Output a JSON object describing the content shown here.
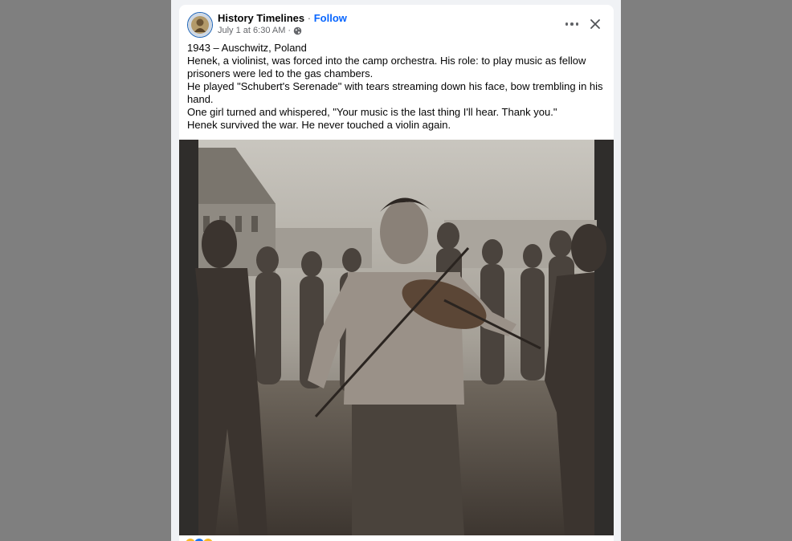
{
  "post": {
    "page_name": "History Timelines",
    "separator": "·",
    "follow_label": "Follow",
    "timestamp": "July 1 at 6:30 AM",
    "meta_separator": "·",
    "audience_icon": "globe-icon",
    "more_icon": "more-horizontal-icon",
    "close_icon": "close-icon",
    "text_lines": [
      "1943 – Auschwitz, Poland",
      "Henek, a  violinist, was forced into the camp orchestra. His role: to play music as fellow",
      "prisoners were led to the gas chambers.",
      "He played \"Schubert's Serenade\" with tears streaming down his face, bow trembling in his",
      "hand.",
      "One girl turned and whispered, \"Your music is the last thing I'll hear. Thank you.\"",
      "Henek survived the war. He never touched a violin again."
    ]
  },
  "colors": {
    "backdrop": "#7f7f7f",
    "accent": "#0866ff",
    "text": "#050505",
    "secondary_text": "#65676b",
    "photo_tone": "#8a857d"
  }
}
